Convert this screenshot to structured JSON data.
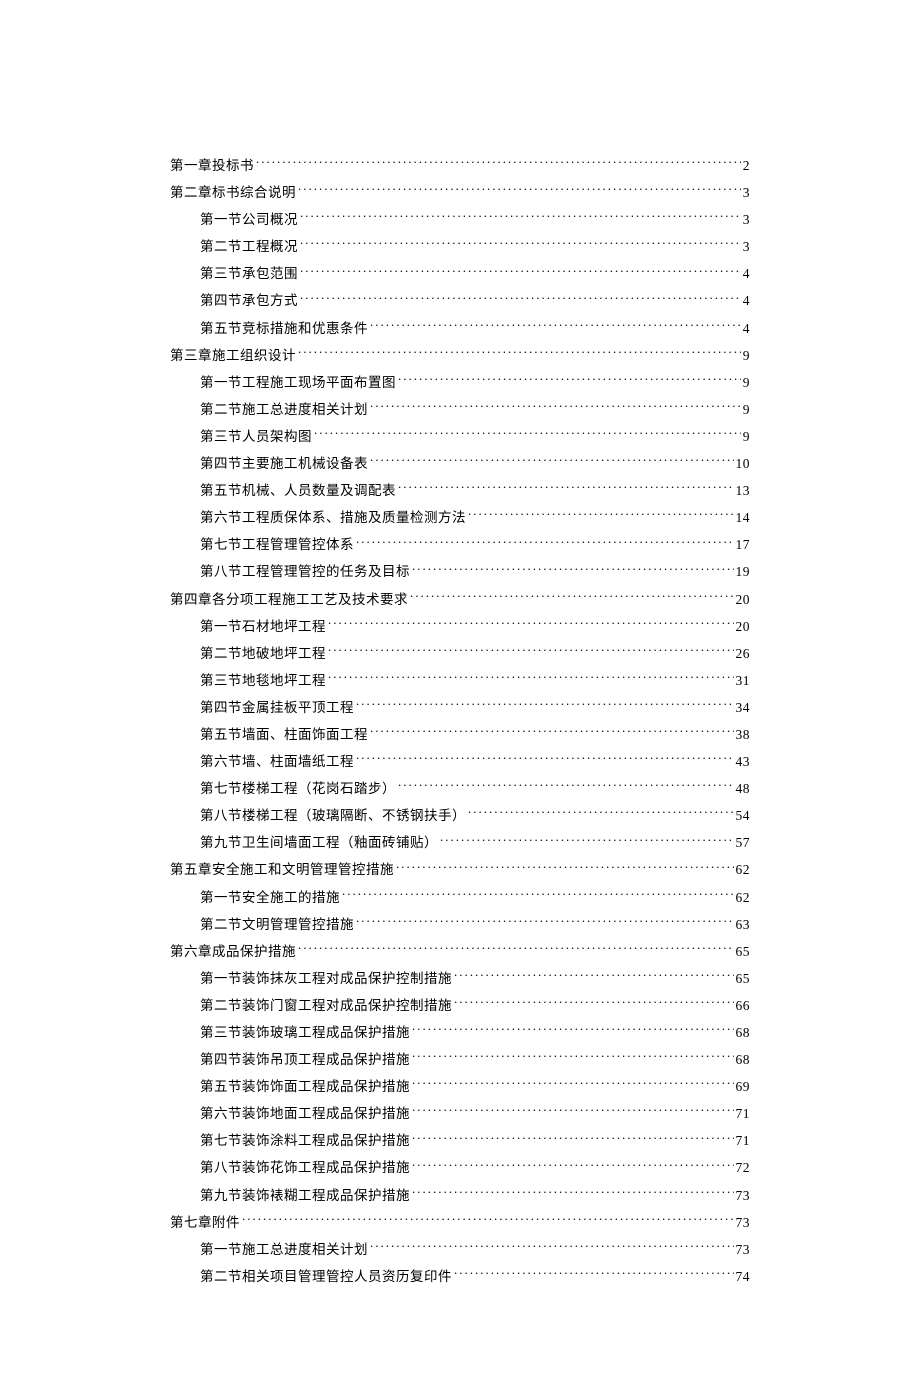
{
  "toc": [
    {
      "label": "第一章投标书",
      "page": "2",
      "level": 0
    },
    {
      "label": "第二章标书综合说明",
      "page": "3",
      "level": 0
    },
    {
      "label": "第一节公司概况",
      "page": "3",
      "level": 1
    },
    {
      "label": "第二节工程概况",
      "page": "3",
      "level": 1
    },
    {
      "label": "第三节承包范围",
      "page": "4",
      "level": 1
    },
    {
      "label": "第四节承包方式",
      "page": "4",
      "level": 1
    },
    {
      "label": "第五节竞标措施和优惠条件",
      "page": "4",
      "level": 1
    },
    {
      "label": "第三章施工组织设计",
      "page": "9",
      "level": 0
    },
    {
      "label": "第一节工程施工现场平面布置图",
      "page": "9",
      "level": 1
    },
    {
      "label": "第二节施工总进度相关计划",
      "page": "9",
      "level": 1
    },
    {
      "label": "第三节人员架构图",
      "page": "9",
      "level": 1
    },
    {
      "label": "第四节主要施工机械设备表",
      "page": "10",
      "level": 1
    },
    {
      "label": "第五节机械、人员数量及调配表",
      "page": "13",
      "level": 1
    },
    {
      "label": "第六节工程质保体系、措施及质量检测方法",
      "page": "14",
      "level": 1
    },
    {
      "label": "第七节工程管理管控体系",
      "page": "17",
      "level": 1
    },
    {
      "label": "第八节工程管理管控的任务及目标",
      "page": "19",
      "level": 1
    },
    {
      "label": "第四章各分项工程施工工艺及技术要求",
      "page": "20",
      "level": 0
    },
    {
      "label": "第一节石材地坪工程",
      "page": "20",
      "level": 1
    },
    {
      "label": "第二节地破地坪工程",
      "page": "26",
      "level": 1
    },
    {
      "label": "第三节地毯地坪工程",
      "page": "31",
      "level": 1
    },
    {
      "label": "第四节金属挂板平顶工程",
      "page": "34",
      "level": 1
    },
    {
      "label": "第五节墙面、柱面饰面工程",
      "page": "38",
      "level": 1
    },
    {
      "label": "第六节墙、柱面墙纸工程",
      "page": "43",
      "level": 1
    },
    {
      "label": "第七节楼梯工程（花岗石踏步）",
      "page": "48",
      "level": 1
    },
    {
      "label": "第八节楼梯工程（玻璃隔断、不锈钢扶手）",
      "page": "54",
      "level": 1
    },
    {
      "label": "第九节卫生间墙面工程（釉面砖铺贴）",
      "page": "57",
      "level": 1
    },
    {
      "label": "第五章安全施工和文明管理管控措施",
      "page": "62",
      "level": 0
    },
    {
      "label": "第一节安全施工的措施",
      "page": "62",
      "level": 1
    },
    {
      "label": "第二节文明管理管控措施",
      "page": "63",
      "level": 1
    },
    {
      "label": "第六章成品保护措施",
      "page": "65",
      "level": 0
    },
    {
      "label": "第一节装饰抹灰工程对成品保护控制措施",
      "page": "65",
      "level": 1
    },
    {
      "label": "第二节装饰门窗工程对成品保护控制措施",
      "page": "66",
      "level": 1
    },
    {
      "label": "第三节装饰玻璃工程成品保护措施",
      "page": "68",
      "level": 1
    },
    {
      "label": "第四节装饰吊顶工程成品保护措施",
      "page": "68",
      "level": 1
    },
    {
      "label": "第五节装饰饰面工程成品保护措施",
      "page": "69",
      "level": 1
    },
    {
      "label": "第六节装饰地面工程成品保护措施",
      "page": "71",
      "level": 1
    },
    {
      "label": "第七节装饰涂料工程成品保护措施",
      "page": "71",
      "level": 1
    },
    {
      "label": "第八节装饰花饰工程成品保护措施",
      "page": "72",
      "level": 1
    },
    {
      "label": "第九节装饰裱糊工程成品保护措施",
      "page": "73",
      "level": 1
    },
    {
      "label": "第七章附件",
      "page": "73",
      "level": 0
    },
    {
      "label": "第一节施工总进度相关计划",
      "page": "73",
      "level": 1
    },
    {
      "label": "第二节相关项目管理管控人员资历复印件",
      "page": "74",
      "level": 1
    }
  ]
}
